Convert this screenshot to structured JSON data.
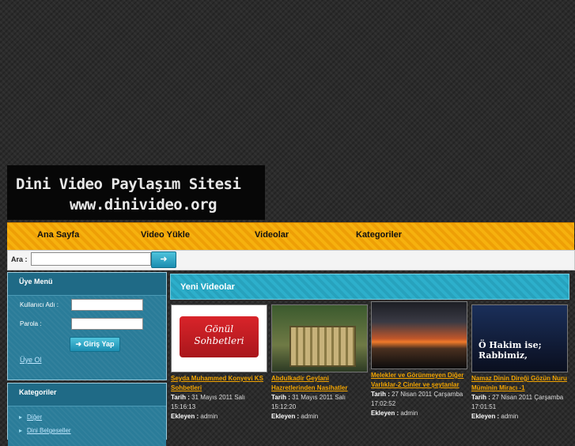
{
  "site": {
    "logo_line1": "Dini Video Paylaşım Sitesi",
    "logo_line2": "www.dinivideo.org"
  },
  "nav": [
    "Ana Sayfa",
    "Video Yükle",
    "Videolar",
    "Kategoriler"
  ],
  "search": {
    "label": "Ara :",
    "button_icon": "arrow-right-icon",
    "value": ""
  },
  "login": {
    "title": "Üye Menü",
    "username_label": "Kullanıcı Adı :",
    "password_label": "Parola :",
    "submit_label": "Giriş Yap",
    "signup_link": "Üye Ol"
  },
  "categories": {
    "title": "Kategoriler",
    "items": [
      "Diğer",
      "Dini Belgeseller"
    ]
  },
  "main": {
    "section_title": "Yeni Videolar",
    "videos": [
      {
        "thumb_text": "Gönül Sohbetleri",
        "title": "Seyda Muhammed Konyevi KS Sohbetleri",
        "date_label": "Tarih :",
        "date": "31 Mayıs 2011 Salı 15:16:13",
        "added_label": "Ekleyen :",
        "added_by": "admin"
      },
      {
        "thumb_text": "",
        "title": "Abdulkadir Geylani Hazretlerinden Nasihatler",
        "date_label": "Tarih :",
        "date": "31 Mayıs 2011 Salı 15:12:20",
        "added_label": "Ekleyen :",
        "added_by": "admin"
      },
      {
        "thumb_text": "",
        "title": "Melekler ve Görünmeyen Diğer Varlıklar-2 Cinler ve şeytanlar",
        "date_label": "Tarih :",
        "date": "27 Nisan 2011 Çarşamba 17:02:52",
        "added_label": "Ekleyen :",
        "added_by": "admin"
      },
      {
        "thumb_text": "Ö Hakim ise; Rabbimiz,",
        "title": "Namaz Dinin Direği Gözün Nuru Müminin Miracı -1",
        "date_label": "Tarih :",
        "date": "27 Nisan 2011 Çarşamba 17:01:51",
        "added_label": "Ekleyen :",
        "added_by": "admin"
      }
    ]
  }
}
